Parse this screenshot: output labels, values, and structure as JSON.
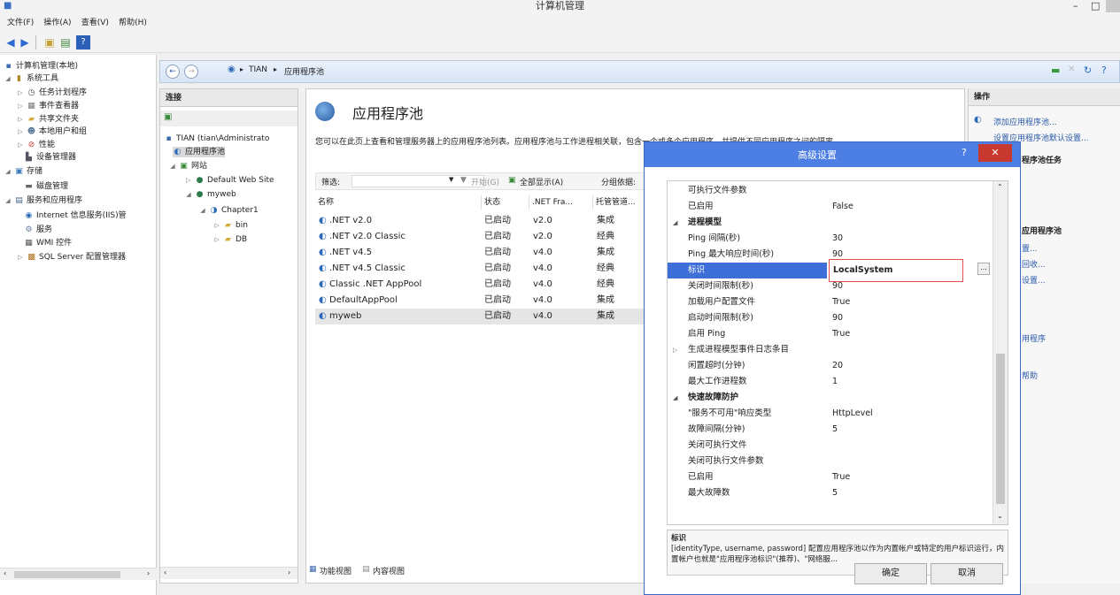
{
  "window": {
    "title": "计算机管理",
    "min": "–",
    "max": "□"
  },
  "menu": [
    "文件(F)",
    "操作(A)",
    "查看(V)",
    "帮助(H)"
  ],
  "tree": [
    {
      "label": "计算机管理(本地)",
      "icon": "computer-icon"
    },
    {
      "label": "系统工具",
      "icon": "tools-icon"
    },
    {
      "label": "任务计划程序",
      "icon": "clock-icon"
    },
    {
      "label": "事件查看器",
      "icon": "event-icon"
    },
    {
      "label": "共享文件夹",
      "icon": "folder-icon"
    },
    {
      "label": "本地用户和组",
      "icon": "users-icon"
    },
    {
      "label": "性能",
      "icon": "performance-icon"
    },
    {
      "label": "设备管理器",
      "icon": "device-icon"
    },
    {
      "label": "存储",
      "icon": "storage-icon"
    },
    {
      "label": "磁盘管理",
      "icon": "disk-icon"
    },
    {
      "label": "服务和应用程序",
      "icon": "services-icon"
    },
    {
      "label": "Internet 信息服务(IIS)管",
      "icon": "iis-icon"
    },
    {
      "label": "服务",
      "icon": "gear-icon"
    },
    {
      "label": "WMI 控件",
      "icon": "wmi-icon"
    },
    {
      "label": "SQL Server 配置管理器",
      "icon": "sql-icon"
    }
  ],
  "address": {
    "parts": [
      "TIAN",
      "应用程序池"
    ]
  },
  "connections": {
    "header": "连接",
    "items": [
      {
        "label": "TIAN (tian\\Administrato"
      },
      {
        "label": "应用程序池"
      },
      {
        "label": "网站"
      },
      {
        "label": "Default Web Site"
      },
      {
        "label": "myweb"
      },
      {
        "label": "Chapter1"
      },
      {
        "label": "bin"
      },
      {
        "label": "DB"
      }
    ]
  },
  "main": {
    "heading": "应用程序池",
    "description": "您可以在此页上查看和管理服务器上的应用程序池列表。应用程序池与工作进程相关联，包含一个或多个应用程序，并提供不同应用程序之间的隔离。",
    "filter_label": "筛选:",
    "go_label": "开始(G)",
    "show_all_label": "全部显示(A)",
    "group_label": "分组依据:",
    "columns": [
      "名称",
      "状态",
      ".NET Fra...",
      "托管管道..."
    ],
    "pools": [
      {
        "name": ".NET v2.0",
        "status": "已启动",
        "clr": "v2.0",
        "pipeline": "集成"
      },
      {
        "name": ".NET v2.0 Classic",
        "status": "已启动",
        "clr": "v2.0",
        "pipeline": "经典"
      },
      {
        "name": ".NET v4.5",
        "status": "已启动",
        "clr": "v4.0",
        "pipeline": "集成"
      },
      {
        "name": ".NET v4.5 Classic",
        "status": "已启动",
        "clr": "v4.0",
        "pipeline": "经典"
      },
      {
        "name": "Classic .NET AppPool",
        "status": "已启动",
        "clr": "v4.0",
        "pipeline": "经典"
      },
      {
        "name": "DefaultAppPool",
        "status": "已启动",
        "clr": "v4.0",
        "pipeline": "集成"
      },
      {
        "name": "myweb",
        "status": "已启动",
        "clr": "v4.0",
        "pipeline": "集成"
      }
    ],
    "features_view": "功能视图",
    "content_view": "内容视图"
  },
  "actions": {
    "header": "操作",
    "items": [
      "添加应用程序池...",
      "设置应用程序池默认设置...",
      "程序池任务",
      "应用程序池",
      "置...",
      "回收...",
      "设置...",
      "用程序",
      "帮助"
    ]
  },
  "dialog": {
    "title": "高级设置",
    "help": "?",
    "close": "✕",
    "rows": [
      {
        "kind": "prop",
        "name": "可执行文件参数",
        "value": ""
      },
      {
        "kind": "prop",
        "name": "已启用",
        "value": "False"
      },
      {
        "kind": "cat",
        "name": "进程模型"
      },
      {
        "kind": "prop",
        "name": "Ping 间隔(秒)",
        "value": "30"
      },
      {
        "kind": "prop",
        "name": "Ping 最大响应时间(秒)",
        "value": "90"
      },
      {
        "kind": "prop",
        "name": "标识",
        "value": "LocalSystem",
        "selected": true
      },
      {
        "kind": "prop",
        "name": "关闭时间限制(秒)",
        "value": "90"
      },
      {
        "kind": "prop",
        "name": "加载用户配置文件",
        "value": "True"
      },
      {
        "kind": "prop",
        "name": "启动时间限制(秒)",
        "value": "90"
      },
      {
        "kind": "prop",
        "name": "启用 Ping",
        "value": "True"
      },
      {
        "kind": "sub",
        "name": "生成进程模型事件日志条目"
      },
      {
        "kind": "prop",
        "name": "闲置超时(分钟)",
        "value": "20"
      },
      {
        "kind": "prop",
        "name": "最大工作进程数",
        "value": "1"
      },
      {
        "kind": "cat",
        "name": "快速故障防护"
      },
      {
        "kind": "prop",
        "name": "\"服务不可用\"响应类型",
        "value": "HttpLevel"
      },
      {
        "kind": "prop",
        "name": "故障间隔(分钟)",
        "value": "5"
      },
      {
        "kind": "prop",
        "name": "关闭可执行文件",
        "value": ""
      },
      {
        "kind": "prop",
        "name": "关闭可执行文件参数",
        "value": ""
      },
      {
        "kind": "prop",
        "name": "已启用",
        "value": "True"
      },
      {
        "kind": "prop",
        "name": "最大故障数",
        "value": "5"
      }
    ],
    "desc_title": "标识",
    "desc_text": "[identityType, username, password] 配置应用程序池以作为内置帐户或特定的用户标识运行，内置帐户也就是\"应用程序池标识\"(推荐)、\"网络服...",
    "ok": "确定",
    "cancel": "取消",
    "ellipsis": "..."
  },
  "colors": {
    "accent": "#4c7ee3",
    "highlight": "#3e6fd8",
    "selection_border": "#e05050"
  }
}
